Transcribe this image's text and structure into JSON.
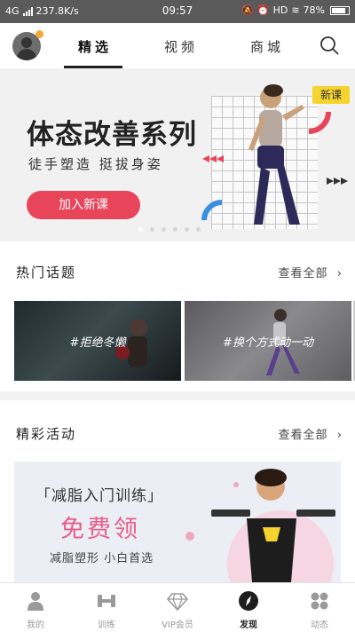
{
  "status_bar": {
    "network": "4G",
    "speed": "237.8K/s",
    "time": "09:57",
    "hd": "HD",
    "battery": "78%"
  },
  "top_nav": {
    "tabs": [
      {
        "label": "精选",
        "active": true
      },
      {
        "label": "视频",
        "active": false
      },
      {
        "label": "商城",
        "active": false
      }
    ],
    "icons": {
      "avatar": "user-avatar",
      "search": "search-icon"
    }
  },
  "banner": {
    "title": "体态改善系列",
    "subtitle": "徒手塑造  挺拔身姿",
    "button": "加入新课",
    "badge": "新课",
    "slide_count": 6,
    "active_slide": 1
  },
  "hot_topics": {
    "title": "热门话题",
    "more": "查看全部",
    "items": [
      {
        "label": "#拒绝冬懒"
      },
      {
        "label": "#换个方式动一动"
      }
    ]
  },
  "activities": {
    "title": "精彩活动",
    "more": "查看全部",
    "card": {
      "title": "「减脂入门训练」",
      "headline": "免费领",
      "subtitle": "减脂塑形  小白首选"
    }
  },
  "bottom_nav": [
    {
      "label": "我的",
      "icon": "person-icon",
      "active": false
    },
    {
      "label": "训练",
      "icon": "dumbbell-icon",
      "active": false
    },
    {
      "label": "VIP会员",
      "icon": "diamond-icon",
      "active": false
    },
    {
      "label": "发现",
      "icon": "compass-icon",
      "active": true
    },
    {
      "label": "动态",
      "icon": "dots-grid-icon",
      "active": false
    }
  ],
  "colors": {
    "accent": "#e9455a",
    "badge": "#f5d430",
    "status_bar": "#5a5a5a"
  }
}
